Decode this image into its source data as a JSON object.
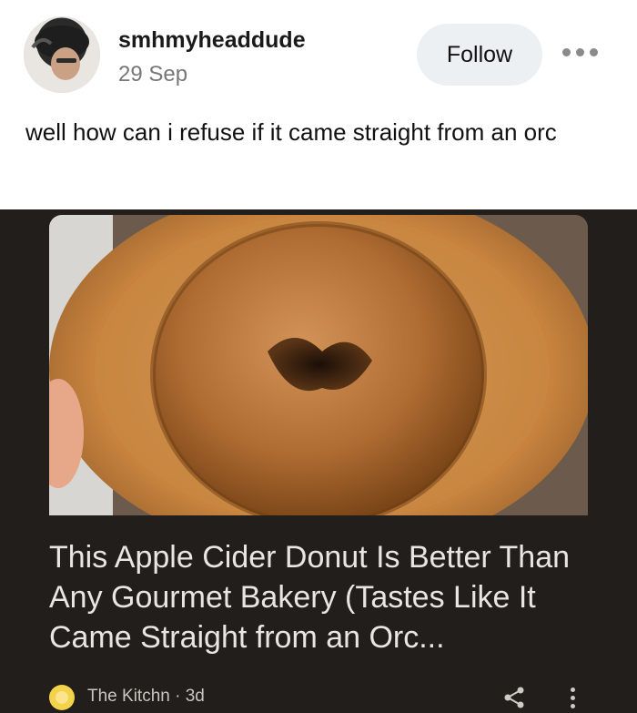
{
  "post": {
    "username": "smhmyheaddude",
    "date": "29 Sep",
    "follow_label": "Follow",
    "text": "well how can i refuse if it came straight from an orc"
  },
  "card": {
    "headline": "This Apple Cider Donut Is Better Than Any Gourmet Bakery (Tastes Like It Came Straight from an Orc...",
    "source": "The Kitchn · 3d",
    "icons": [
      "share-icon",
      "more-vertical-icon"
    ]
  },
  "colors": {
    "card_background": "#221e1c",
    "follow_button": "#edf0f2",
    "headline_text": "#e9e6e2"
  }
}
